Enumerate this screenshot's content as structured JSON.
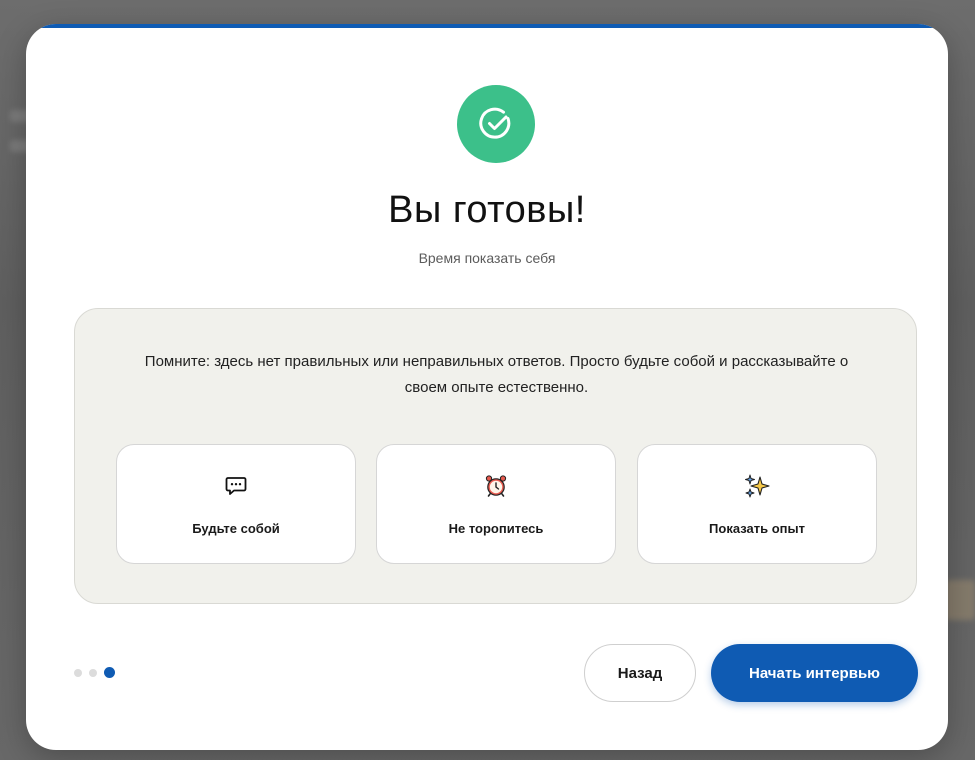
{
  "modal": {
    "title": "Вы готовы!",
    "subtitle": "Время показать себя",
    "accent_color": "#0f5bb3",
    "success_color": "#3cc08a",
    "success_icon": "check-circle-icon"
  },
  "panel": {
    "text": "Помните: здесь нет правильных или неправильных ответов. Просто будьте собой и рассказывайте о своем опыте естественно.",
    "features": [
      {
        "icon": "chat-bubble-icon",
        "label": "Будьте собой"
      },
      {
        "icon": "alarm-clock-icon",
        "label": "Не торопитесь"
      },
      {
        "icon": "sparkles-icon",
        "label": "Показать опыт"
      }
    ]
  },
  "pagination": {
    "total": 3,
    "current": 3
  },
  "buttons": {
    "back_label": "Назад",
    "start_label": "Начать интервью"
  }
}
